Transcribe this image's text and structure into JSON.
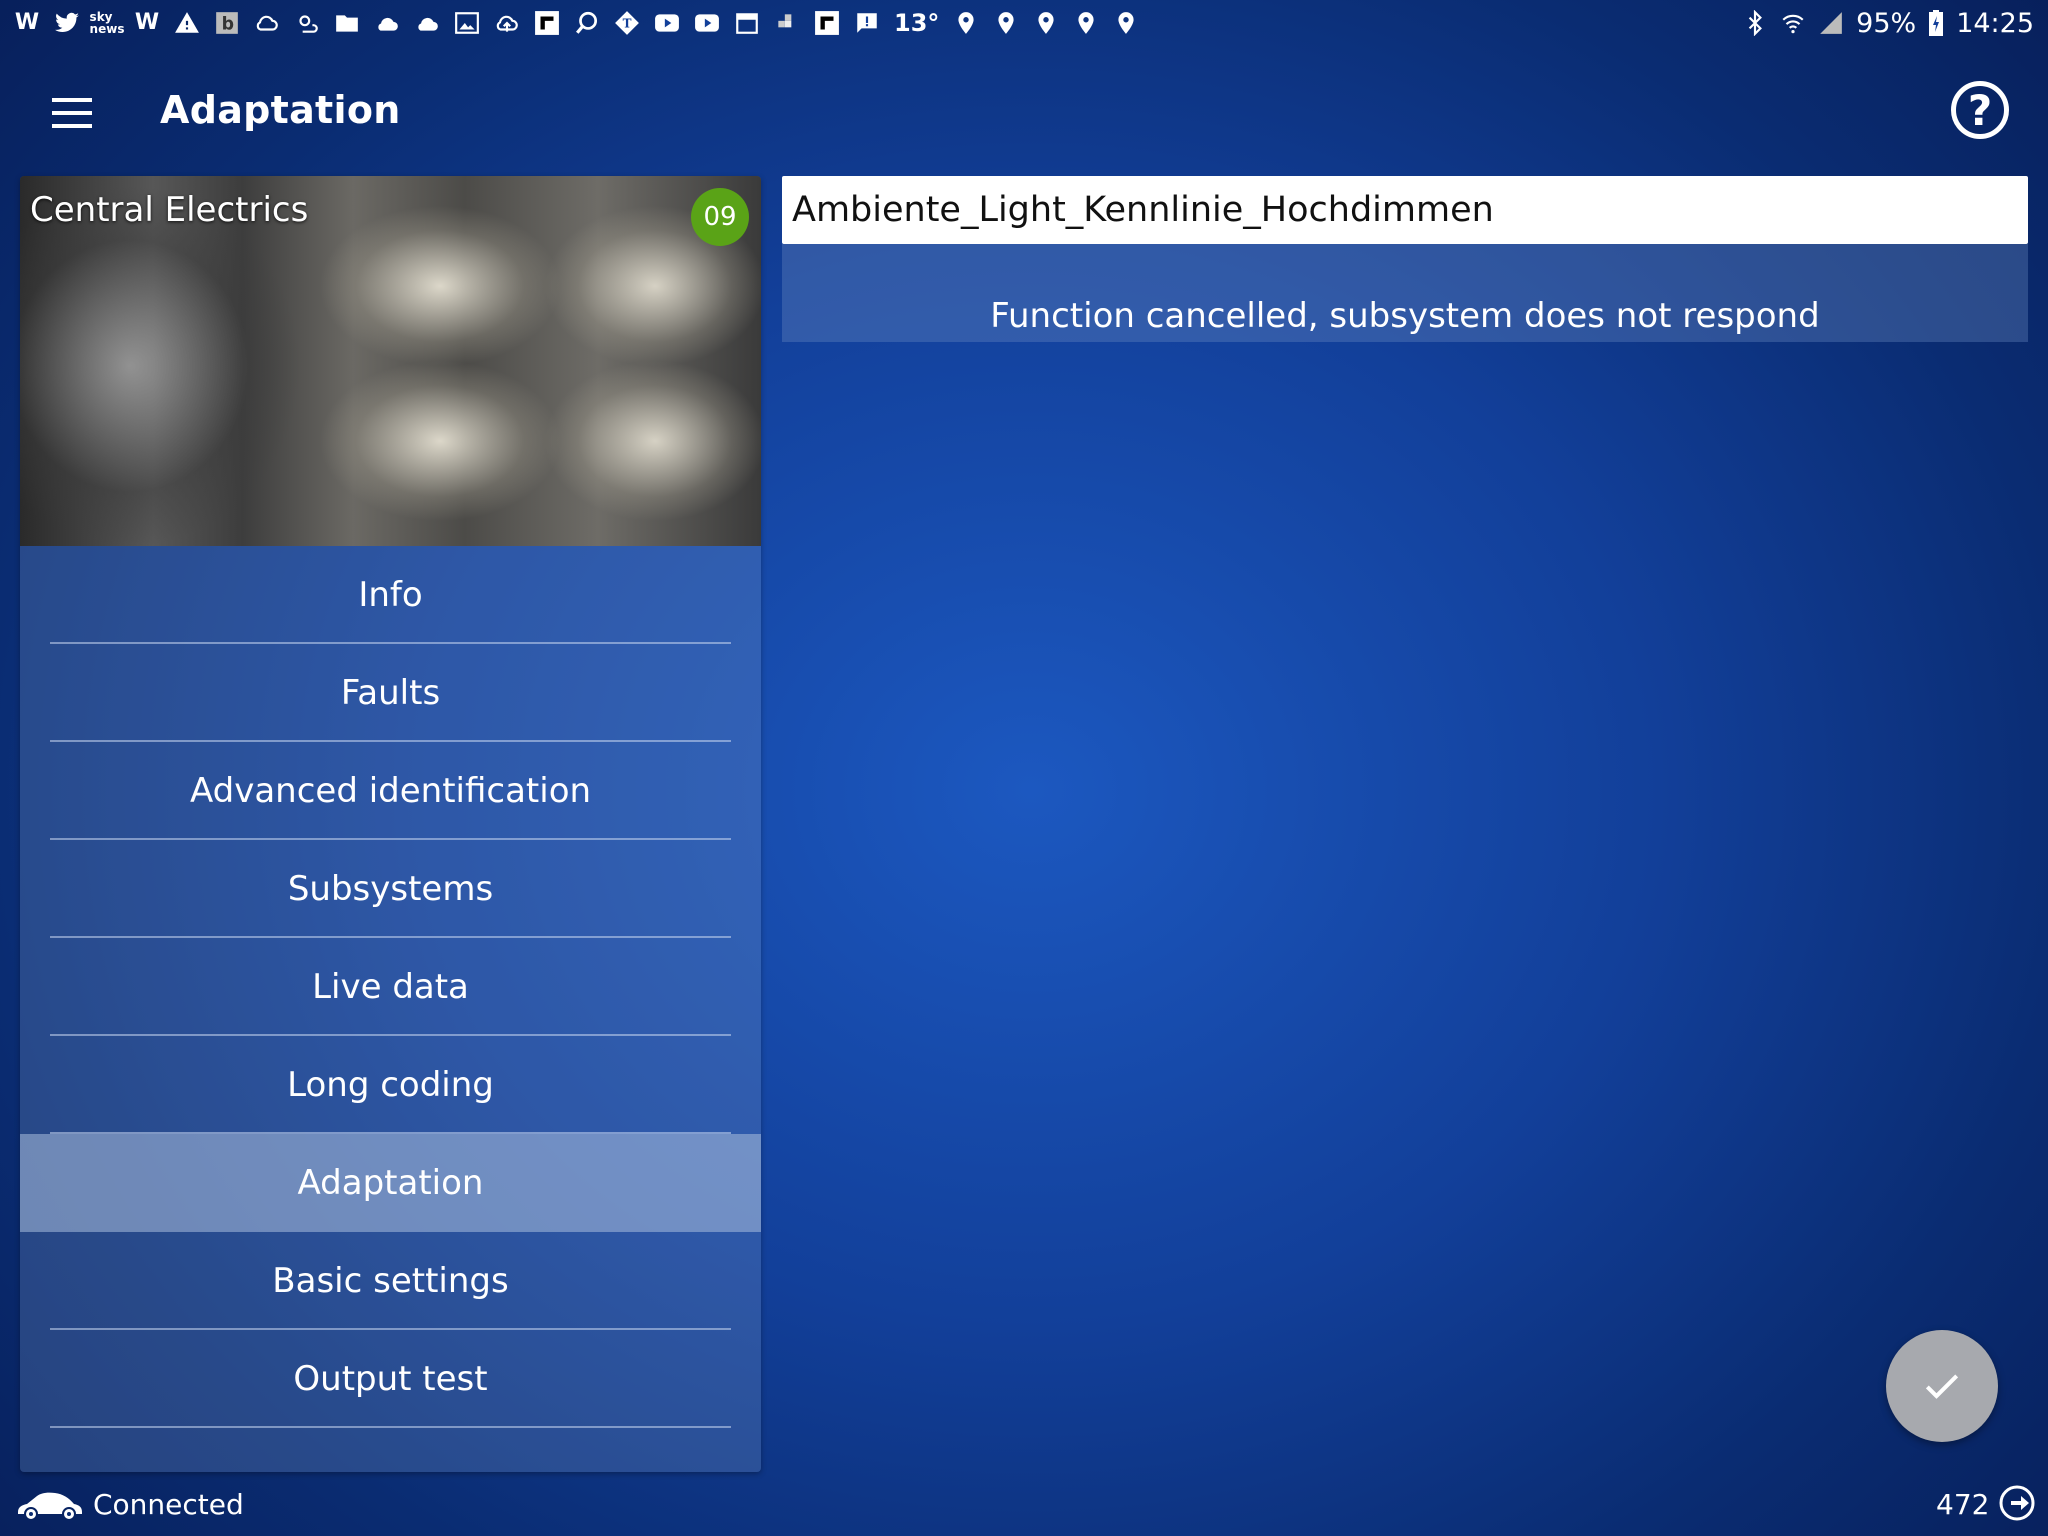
{
  "status_bar": {
    "left_icons": [
      "w-icon",
      "twitter-icon",
      "sky-news-icon",
      "w-icon",
      "warning-icon",
      "b-icon",
      "cloud-icon",
      "weather-icon",
      "folder-icon",
      "cloud-icon",
      "cloud-icon",
      "image-icon",
      "cloud-upload-icon",
      "flipboard-icon",
      "search-icon",
      "telegraph-icon",
      "youtube-icon",
      "youtube-icon",
      "calendar-icon",
      "slack-icon",
      "flipboard-icon",
      "message-icon"
    ],
    "temperature": "13°",
    "location_icons": 5,
    "battery": "95%",
    "time": "14:25"
  },
  "app_bar": {
    "title": "Adaptation"
  },
  "control_unit": {
    "name": "Central Electrics",
    "address": "09"
  },
  "menu": {
    "items": [
      {
        "label": "Info",
        "active": false
      },
      {
        "label": "Faults",
        "active": false
      },
      {
        "label": "Advanced identification",
        "active": false
      },
      {
        "label": "Subsystems",
        "active": false
      },
      {
        "label": "Live data",
        "active": false
      },
      {
        "label": "Long coding",
        "active": false
      },
      {
        "label": "Adaptation",
        "active": true
      },
      {
        "label": "Basic settings",
        "active": false
      },
      {
        "label": "Output test",
        "active": false
      }
    ]
  },
  "adaptation": {
    "channel_name": "Ambiente_Light_Kennlinie_Hochdimmen",
    "result_message": "Function cancelled, subsystem does not respond"
  },
  "footer": {
    "connection_status": "Connected",
    "counter": "472"
  },
  "colors": {
    "badge": "#5aa317",
    "background_center": "#1c58c0",
    "background_edge": "#071f5a",
    "fab": "#a7a9ae"
  }
}
